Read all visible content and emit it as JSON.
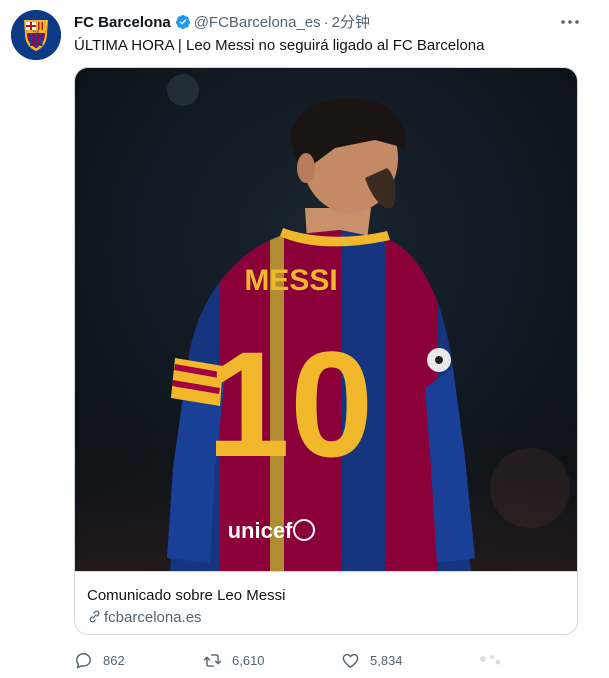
{
  "tweet": {
    "author_name": "FC Barcelona",
    "handle": "@FCBarcelona_es",
    "separator": "·",
    "time": "2分钟",
    "text": "ÚLTIMA HORA | Leo Messi no seguirá ligado al FC Barcelona",
    "avatar_crest_letters": "FCB"
  },
  "card": {
    "title": "Comunicado sobre Leo Messi",
    "domain": "fcbarcelona.es",
    "jersey_name": "MESSI",
    "jersey_number": "10",
    "sponsor": "unicef"
  },
  "actions": {
    "reply_count": "862",
    "retweet_count": "6,610",
    "like_count": "5,834"
  },
  "colors": {
    "verified": "#1d9bf0",
    "muted_text": "#536471",
    "border": "#cfd9de",
    "blaugrana_blue": "#1a3f96",
    "blaugrana_red": "#a50044",
    "gold": "#f2b82b"
  },
  "icons": [
    "fcb-crest-icon",
    "verified-badge-icon",
    "more-options-icon",
    "link-icon",
    "reply-icon",
    "retweet-icon",
    "like-icon"
  ]
}
